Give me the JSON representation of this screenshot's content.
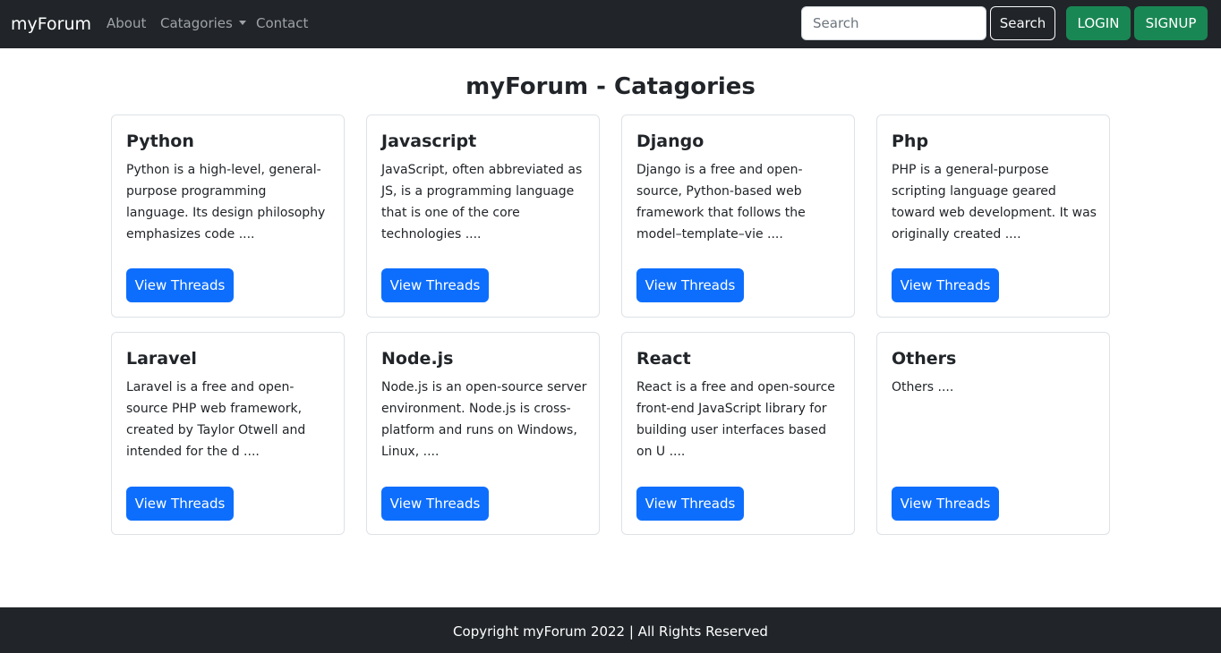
{
  "navbar": {
    "brand": "myForum",
    "links": [
      {
        "label": "About"
      },
      {
        "label": "Catagories"
      },
      {
        "label": "Contact"
      }
    ],
    "search_placeholder": "Search",
    "search_button": "Search",
    "login_button": "LOGIN",
    "signup_button": "SIGNUP"
  },
  "page": {
    "title": "myForum - Catagories"
  },
  "categories": [
    {
      "title": "Python",
      "description": "Python is a high-level, general-purpose programming language. Its design philosophy emphasizes code ....",
      "button": "View Threads"
    },
    {
      "title": "Javascript",
      "description": "JavaScript, often abbreviated as JS, is a programming language that is one of the core technologies ....",
      "button": "View Threads"
    },
    {
      "title": "Django",
      "description": "Django is a free and open-source, Python-based web framework that follows the model–template–vie ....",
      "button": "View Threads"
    },
    {
      "title": "Php",
      "description": "PHP is a general-purpose scripting language geared toward web development. It was originally created ....",
      "button": "View Threads"
    },
    {
      "title": "Laravel",
      "description": "Laravel is a free and open-source PHP web framework, created by Taylor Otwell and intended for the d ....",
      "button": "View Threads"
    },
    {
      "title": "Node.js",
      "description": "Node.js is an open-source server environment. Node.js is cross-platform and runs on Windows, Linux, ....",
      "button": "View Threads"
    },
    {
      "title": "React",
      "description": "React is a free and open-source front-end JavaScript library for building user interfaces based on U ....",
      "button": "View Threads"
    },
    {
      "title": "Others",
      "description": "Others ....",
      "button": "View Threads"
    }
  ],
  "footer": {
    "text": "Copyright myForum 2022 | All Rights Reserved"
  },
  "colors": {
    "navbar_bg": "#212529",
    "primary": "#0d6efd",
    "success": "#198754",
    "card_border": "#dee2e6"
  }
}
